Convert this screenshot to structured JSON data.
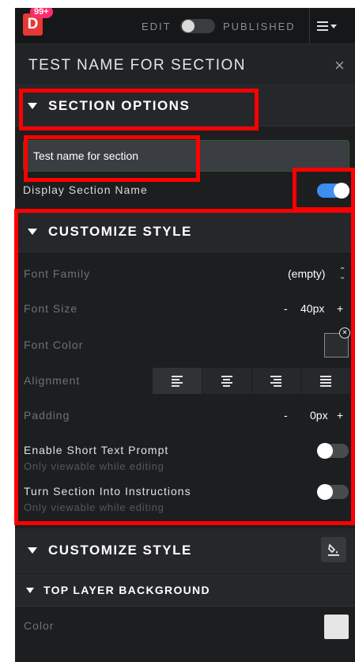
{
  "header": {
    "logo_letter": "D",
    "notification_badge": "99+",
    "edit_label": "EDIT",
    "published_label": "PUBLISHED",
    "mode_toggle_on": false
  },
  "panel": {
    "title": "TEST NAME FOR SECTION",
    "close_icon": "×"
  },
  "section_options": {
    "heading": "SECTION OPTIONS",
    "name_value": "Test name for section",
    "display_name_label": "Display Section Name",
    "display_name_on": true
  },
  "customize_style": {
    "heading": "CUSTOMIZE STYLE",
    "font_family_label": "Font Family",
    "font_family_value": "(empty)",
    "font_family_stepper": "⌃⌄",
    "font_size_label": "Font Size",
    "font_size_minus": "-",
    "font_size_value": "40px",
    "font_size_plus": "+",
    "font_color_label": "Font Color",
    "font_color_clear": "×",
    "alignment_label": "Alignment",
    "alignment_options": [
      "left-align-icon",
      "center-align-icon",
      "right-align-icon",
      "justify-align-icon"
    ],
    "padding_label": "Padding",
    "padding_minus": "-",
    "padding_value": "0px",
    "padding_plus": "+",
    "short_prompt_label": "Enable Short Text Prompt",
    "short_prompt_sub": "Only viewable while editing",
    "short_prompt_on": false,
    "instructions_label": "Turn Section Into Instructions",
    "instructions_sub": "Only viewable while editing",
    "instructions_on": false
  },
  "customize_style_2": {
    "heading": "CUSTOMIZE STYLE",
    "paint_icon": "paint-bucket-icon"
  },
  "top_layer_background": {
    "heading": "TOP LAYER BACKGROUND",
    "color_label": "Color",
    "color_value": "#e6e6e6"
  },
  "colors": {
    "panel_bg": "#1d1e20",
    "accent_toggle": "#3d8ef0",
    "logo_red": "#e53935",
    "badge_pink": "#ff2d6d",
    "annotation_red": "#ff0000"
  }
}
